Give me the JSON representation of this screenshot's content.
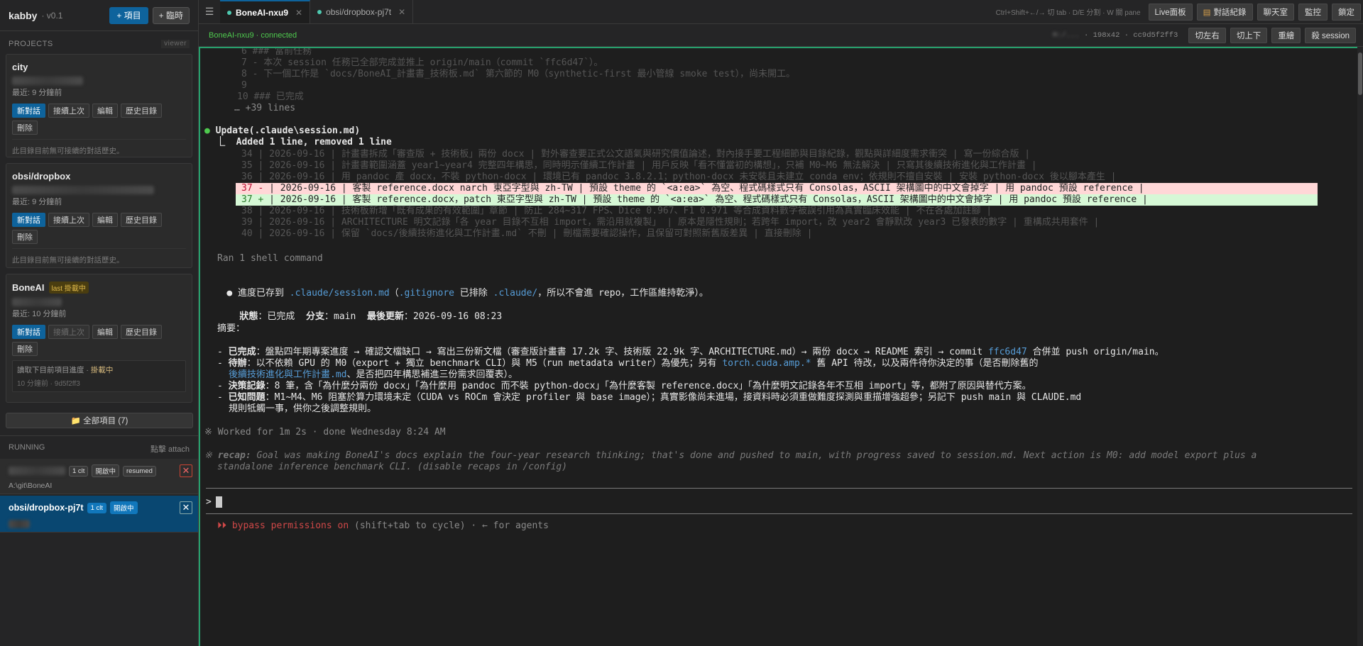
{
  "app": {
    "name": "kabby",
    "version": "· v0.1",
    "new_project": "+ 項目",
    "temp": "+ 臨時"
  },
  "sidebar": {
    "projects_label": "PROJECTS",
    "viewer_tag": "viewer",
    "projects": [
      {
        "name": "city",
        "badge": "",
        "recent": "最近: 9 分鐘前",
        "actions": [
          "新對話",
          "接續上次",
          "編輯",
          "歷史目錄",
          "刪除"
        ],
        "note": "此目錄目前無可接續的對話歷史。"
      },
      {
        "name": "obsi/dropbox",
        "badge": "",
        "recent": "最近: 9 分鐘前",
        "actions": [
          "新對話",
          "接續上次",
          "編輯",
          "歷史目錄",
          "刪除"
        ],
        "note": "此目錄目前無可接續的對話歷史。"
      },
      {
        "name": "BoneAI",
        "badge": "last 掛載中",
        "recent": "最近: 10 分鐘前",
        "actions": [
          "新對話",
          "接續上次",
          "編輯",
          "歷史目錄",
          "刪除"
        ],
        "note_line1": "讀取下目前項目進度 · ",
        "note_highlight": "掛載中",
        "note_line2": "10 分鐘前 · 9d5f2ff3"
      }
    ],
    "all_projects": "全部項目 (7)",
    "running_label": "RUNNING",
    "attach_label": "點擊 attach",
    "running": [
      {
        "name": "",
        "pills": [
          "1 clt",
          "開啟中",
          "resumed"
        ],
        "sub": "A:\\git\\BoneAI"
      },
      {
        "name": "obsi/dropbox-pj7t",
        "pills": [
          "1 clt",
          "開啟中"
        ],
        "sub": ""
      }
    ]
  },
  "topbar": {
    "tabs": [
      {
        "label": "BoneAI-nxu9",
        "active": true
      },
      {
        "label": "obsi/dropbox-pj7t",
        "active": false
      }
    ],
    "hint": "Ctrl+Shift+←/→ 切 tab · D/E 分割 · W 關 pane",
    "buttons": [
      "Live面板",
      "對話紀錄",
      "聊天室",
      "監控",
      "鎖定"
    ]
  },
  "status": {
    "connection": "BoneAI-nxu9 · connected",
    "meta_blur": "M:/...",
    "meta": "· 198x42 · cc9d5f2ff3",
    "buttons": [
      "切左右",
      "切上下",
      "重繪",
      "殺 session"
    ]
  },
  "terminal": {
    "top_lines": [
      "6 ### 當前任務",
      "7 - 本次 session 任務已全部完成並推上 origin/main（commit `ffc6d47`）。",
      "8 - 下一個工作是 `docs/BoneAI_計畫書_技術板.md` 第六節的 M0（synthetic-first 最小管線 smoke test），尚未開工。",
      "9",
      "10 ### 已完成"
    ],
    "more_lines": "… +39 lines",
    "update_label": "Update(.claude\\session.md)",
    "update_summary": "⎿  Added 1 line, removed 1 line",
    "diff_context_before": [
      "34 | 2026-09-16 | 計畫書拆成「審查版 + 技術板」兩份 docx | 對外審查要正式公文語氣與研究價值論述，對內接手要工程細節與目錄紀錄，觀點與詳細度需求衝突 | 寫一份綜合版 |",
      "35 | 2026-09-16 | 計畫書範圍涵蓋 year1~year4 完整四年構思，同時明示僅續工作計畫 | 用戶反映「看不懂當初的構想」，只補 M0~M6 無法解決 | 只寫其後續技術進化與工作計畫 |",
      "36 | 2026-09-16 | 用 pandoc 產 docx，不裝 python-docx | 環境已有 pandoc 3.8.2.1；python-docx 未安裝且未建立 conda env；依規則不擅自安裝 | 安裝 python-docx 後以腳本產生 |"
    ],
    "diff_del": {
      "num": "37 -",
      "text": "| 2026-09-16 | 客製 reference.docx narch 東亞字型與 zh-TW | 預設 theme 的 `<a:ea>` 為空、程式碼樣式只有 Consolas，ASCII 架構圖中的中文會掉字 | 用 pandoc 預設 reference |"
    },
    "diff_add": {
      "num": "37 +",
      "text": "| 2026-09-16 | 客製 reference.docx，patch 東亞字型與 zh-TW | 預設 theme 的 `<a:ea>` 為空、程式碼樣式只有 Consolas，ASCII 架構圖中的中文會掉字 | 用 pandoc 預設 reference |"
    },
    "diff_context_after": [
      "38 | 2026-09-16 | 技術板新增「既有成果的有效範圍」章節 | 防止 284~317 FPS、Dice 0.967、F1 0.971 等合成資料數字被誤引用為真實臨床效能 | 不在各處加註腳 |",
      "39 | 2026-09-16 | ARCHITECTURE 明文記錄「各 year 目錄不互相 import，需沿用就複製」 | 原本是隱性規則；若跨年 import，改 year2 會靜默改 year3 已發表的數字 | 重構成共用套件 |",
      "40 | 2026-09-16 | 保留 `docs/後續技術進化與工作計畫.md` 不刪 | 刪檔需要確認操作，且保留可對照新舊版差異 | 直接刪除 |"
    ],
    "shell_line": "Ran 1 shell command",
    "saved_pre": "進度已存到 ",
    "saved_link1": ".claude/session.md",
    "saved_mid1": "（",
    "saved_link2": ".gitignore",
    "saved_mid2": " 已排除 ",
    "saved_link3": ".claude/",
    "saved_post": "，所以不會進 repo，工作區維持乾淨）。",
    "state_label": "狀態",
    "state_value": "：已完成  ",
    "branch_label": "分支",
    "branch_value": "：main  ",
    "updated_label": "最後更新",
    "updated_value": "：2026-09-16 08:23",
    "summary_label": "摘要：",
    "b1_label": "已完成",
    "b1_text": "：盤點四年期專案進度 → 確認文檔缺口 → 寫出三份新文檔（審查版計畫書 17.2k 字、技術版 22.9k 字、ARCHITECTURE.md）→ 兩份 docx → README 索引 → commit ",
    "b1_link": "ffc6d47",
    "b1_end": " 合併並 push origin/main。",
    "b2_label": "待辦",
    "b2_text": "：以不依賴 GPU 的 M0（export + 獨立 benchmark CLI）與 M5（run metadata writer）為優先；另有 ",
    "b2_link": "torch.cuda.amp.*",
    "b2_text2": " 舊 API 待改，以及兩件待你決定的事（是否刪除舊的",
    "b2_link2": "後續技術進化與工作計畫.md",
    "b2_end": "、是否把四年構思補進三份需求回覆表）。",
    "b3_label": "決策記錄",
    "b3_text": "：8 筆，含「為什麼分兩份 docx」「為什麼用 pandoc 而不裝 python-docx」「為什麼客製 reference.docx」「為什麼明文記錄各年不互相 import」等，都附了原因與替代方案。",
    "b4_label": "已知問題",
    "b4_text": "：M1~M4、M6 阻塞於算力環境未定（CUDA vs ROCm 會決定 profiler 與 base image）；真實影像尚未進場，接資料時必須重做難度探測與重描增強超參；另記下 push main 與 CLAUDE.md",
    "b4_text2": "規則牴觸一事，供你之後調整規則。",
    "worked": "※ Worked for 1m 2s · done Wednesday 8:24 AM",
    "recap_label": "recap:",
    "recap_text": " Goal was making BoneAI's docs explain the four-year research thinking; that's done and pushed to main, with progress saved to session.md. Next action is M0: add model export plus a",
    "recap_text2": "standalone inference benchmark CLI. (disable recaps in /config)",
    "prompt": ">",
    "perm_mode": "⏵⏵ bypass permissions on",
    "perm_hint": " (shift+tab to cycle) · ← for agents"
  }
}
